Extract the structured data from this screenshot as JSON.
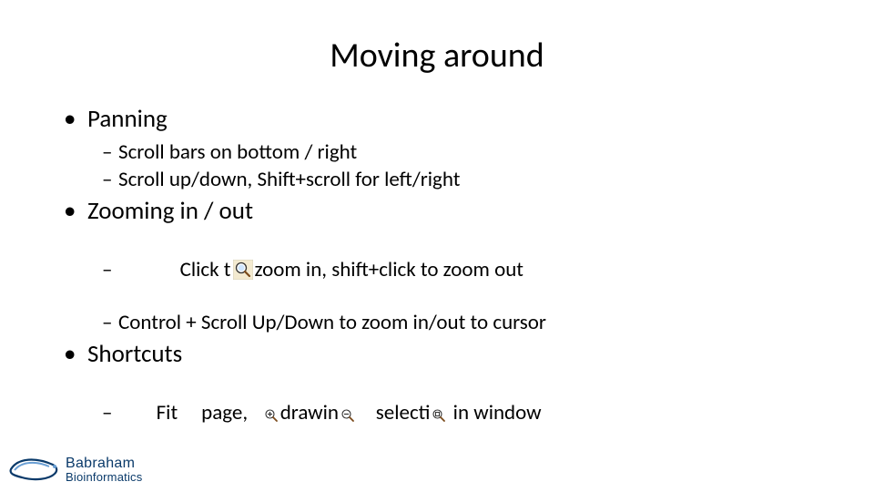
{
  "title": "Moving around",
  "sections": [
    {
      "heading": "Panning",
      "items": [
        {
          "text": "Scroll bars on bottom / right"
        },
        {
          "text": "Scroll up/down, Shift+scroll for left/right"
        }
      ]
    },
    {
      "heading": "Zooming in / out",
      "items": [
        {
          "pre": "     Click t",
          "icon": "magnifier",
          "post": "zoom in, shift+click to zoom out"
        },
        {
          "text": "Control + Scroll Up/Down to zoom in/out to cursor"
        }
      ]
    },
    {
      "heading": "Shortcuts",
      "items": [
        {
          "segments": [
            {
              "text": "Fit     page,   "
            },
            {
              "icon": "zoom-in-small"
            },
            {
              "text": "drawin"
            },
            {
              "icon": "zoom-out-small"
            },
            {
              "text": "    selecti"
            },
            {
              "icon": "zoom-fit-small"
            },
            {
              "text": " in window"
            }
          ]
        }
      ]
    }
  ],
  "logo": {
    "line1": "Babraham",
    "line2": "Bioinformatics"
  }
}
